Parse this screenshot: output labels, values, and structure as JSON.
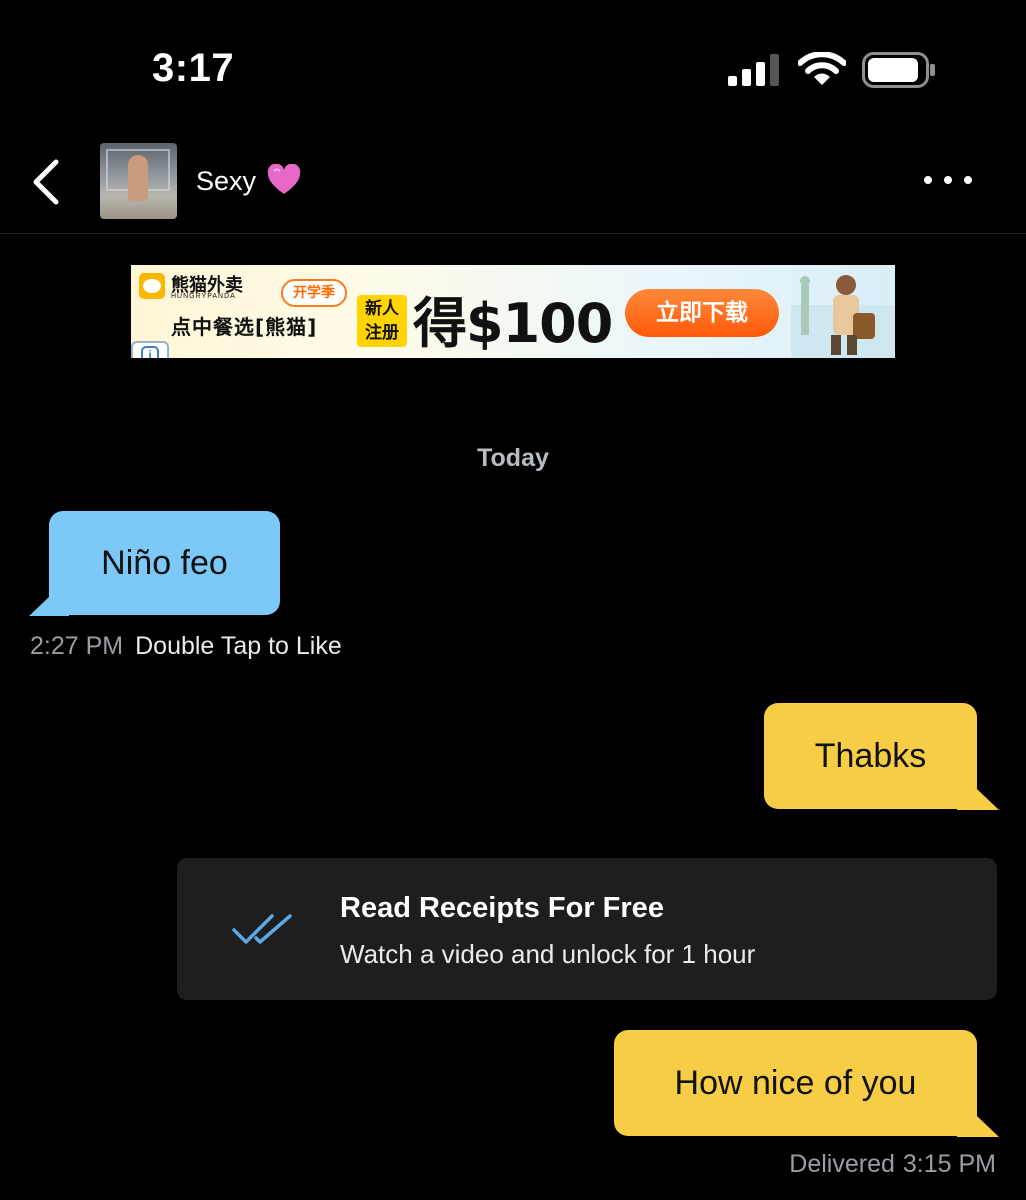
{
  "status_bar": {
    "time": "3:17",
    "icons": [
      "cellular-signal-icon",
      "wifi-icon",
      "battery-icon"
    ]
  },
  "header": {
    "back_icon": "chevron-left-icon",
    "contact_name": "Sexy",
    "contact_emoji": "pink-heart-icon",
    "more_icon": "more-horizontal-icon"
  },
  "ad": {
    "brand": "熊猫外卖",
    "brand_sub": "HUNGRYPANDA",
    "bubble": "开学季",
    "slogan": "点中餐选[熊猫]",
    "new_user": "新人注册",
    "amount": "得$100",
    "cta": "立即下载",
    "info_icon": "info-icon"
  },
  "chat": {
    "date_divider": "Today",
    "messages": [
      {
        "direction": "incoming",
        "text": "Niño feo",
        "time": "2:27 PM",
        "action": "Double Tap to Like"
      },
      {
        "direction": "outgoing",
        "text": "Thabks"
      },
      {
        "direction": "outgoing",
        "text": "How nice of you",
        "status": "Delivered",
        "time": "3:15 PM"
      }
    ],
    "read_receipts": {
      "icon": "double-check-icon",
      "title": "Read Receipts For Free",
      "subtitle": "Watch a video and unlock for 1 hour"
    }
  },
  "colors": {
    "background": "#000000",
    "incoming_bubble": "#7cc8f7",
    "outgoing_bubble": "#f6cd45",
    "card": "#1e1e1f",
    "accent_check": "#5aa9e6"
  }
}
